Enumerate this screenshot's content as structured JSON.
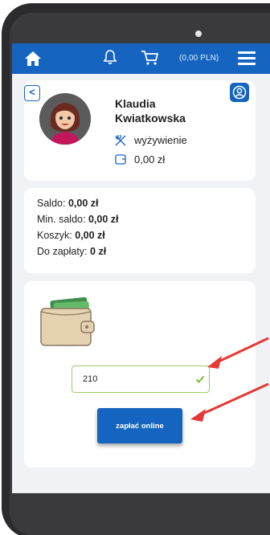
{
  "header": {
    "balance_label": "(0,00 PLN)"
  },
  "profile": {
    "first_name": "Klaudia",
    "last_name": "Kwiatkowska",
    "meal_plan": "wyżywienie",
    "wallet_value": "0,00 zł",
    "back_glyph": "<"
  },
  "balance": {
    "saldo_label": "Saldo:",
    "saldo_value": "0,00 zł",
    "min_saldo_label": "Min. saldo:",
    "min_saldo_value": "0,00 zł",
    "koszyk_label": "Koszyk:",
    "koszyk_value": "0,00 zł",
    "do_zaplaty_label": "Do zapłaty:",
    "do_zaplaty_value": "0 zł"
  },
  "payment": {
    "amount_value": "210",
    "pay_button_label": "zapłać online"
  },
  "icons": {
    "home": "home-icon",
    "bell": "bell-icon",
    "cart": "cart-icon",
    "menu": "menu-icon",
    "user": "user-icon",
    "meal": "fork-knife-icon",
    "wallet_small": "wallet-icon",
    "check": "check-icon"
  },
  "colors": {
    "brand_blue": "#1565c0",
    "screen_bg": "#f1f2f6",
    "valid_green": "#8bc34a",
    "annotation_red": "#e53935"
  }
}
